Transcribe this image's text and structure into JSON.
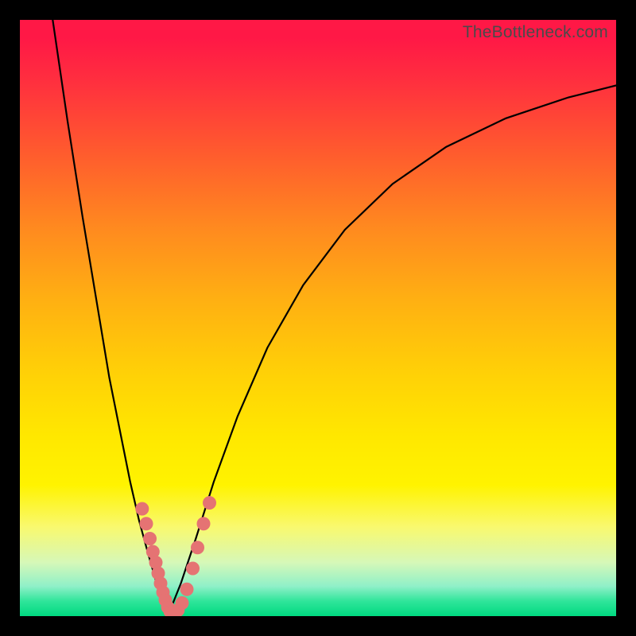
{
  "watermark": "TheBottleneck.com",
  "chart_data": {
    "type": "line",
    "title": "",
    "xlabel": "",
    "ylabel": "",
    "xrange": [
      0,
      1
    ],
    "yrange": [
      0,
      1
    ],
    "note": "Axes are unlabeled; values are normalized pixel-space estimates (0=left/bottom, 1=right/top).",
    "series": [
      {
        "name": "left-branch",
        "x": [
          0.055,
          0.08,
          0.105,
          0.13,
          0.15,
          0.17,
          0.185,
          0.2,
          0.215,
          0.228,
          0.24,
          0.25
        ],
        "y": [
          1.0,
          0.83,
          0.67,
          0.52,
          0.4,
          0.3,
          0.225,
          0.16,
          0.105,
          0.06,
          0.025,
          0.005
        ]
      },
      {
        "name": "right-branch",
        "x": [
          0.25,
          0.27,
          0.295,
          0.325,
          0.365,
          0.415,
          0.475,
          0.545,
          0.625,
          0.715,
          0.815,
          0.92,
          1.0
        ],
        "y": [
          0.005,
          0.055,
          0.13,
          0.225,
          0.335,
          0.45,
          0.555,
          0.648,
          0.725,
          0.787,
          0.835,
          0.87,
          0.89
        ]
      }
    ],
    "marker_series": {
      "name": "salmon-dots",
      "points": [
        {
          "x": 0.205,
          "y": 0.18
        },
        {
          "x": 0.212,
          "y": 0.155
        },
        {
          "x": 0.218,
          "y": 0.13
        },
        {
          "x": 0.223,
          "y": 0.108
        },
        {
          "x": 0.228,
          "y": 0.09
        },
        {
          "x": 0.232,
          "y": 0.072
        },
        {
          "x": 0.236,
          "y": 0.055
        },
        {
          "x": 0.24,
          "y": 0.04
        },
        {
          "x": 0.244,
          "y": 0.027
        },
        {
          "x": 0.248,
          "y": 0.015
        },
        {
          "x": 0.252,
          "y": 0.008
        },
        {
          "x": 0.258,
          "y": 0.006
        },
        {
          "x": 0.265,
          "y": 0.01
        },
        {
          "x": 0.272,
          "y": 0.022
        },
        {
          "x": 0.28,
          "y": 0.045
        },
        {
          "x": 0.29,
          "y": 0.08
        },
        {
          "x": 0.298,
          "y": 0.115
        },
        {
          "x": 0.308,
          "y": 0.155
        },
        {
          "x": 0.318,
          "y": 0.19
        }
      ]
    },
    "background_gradient_stops": [
      {
        "pos": 0.0,
        "color": "#ff1846"
      },
      {
        "pos": 0.5,
        "color": "#ffc400"
      },
      {
        "pos": 0.78,
        "color": "#fff300"
      },
      {
        "pos": 1.0,
        "color": "#00d980"
      }
    ]
  }
}
